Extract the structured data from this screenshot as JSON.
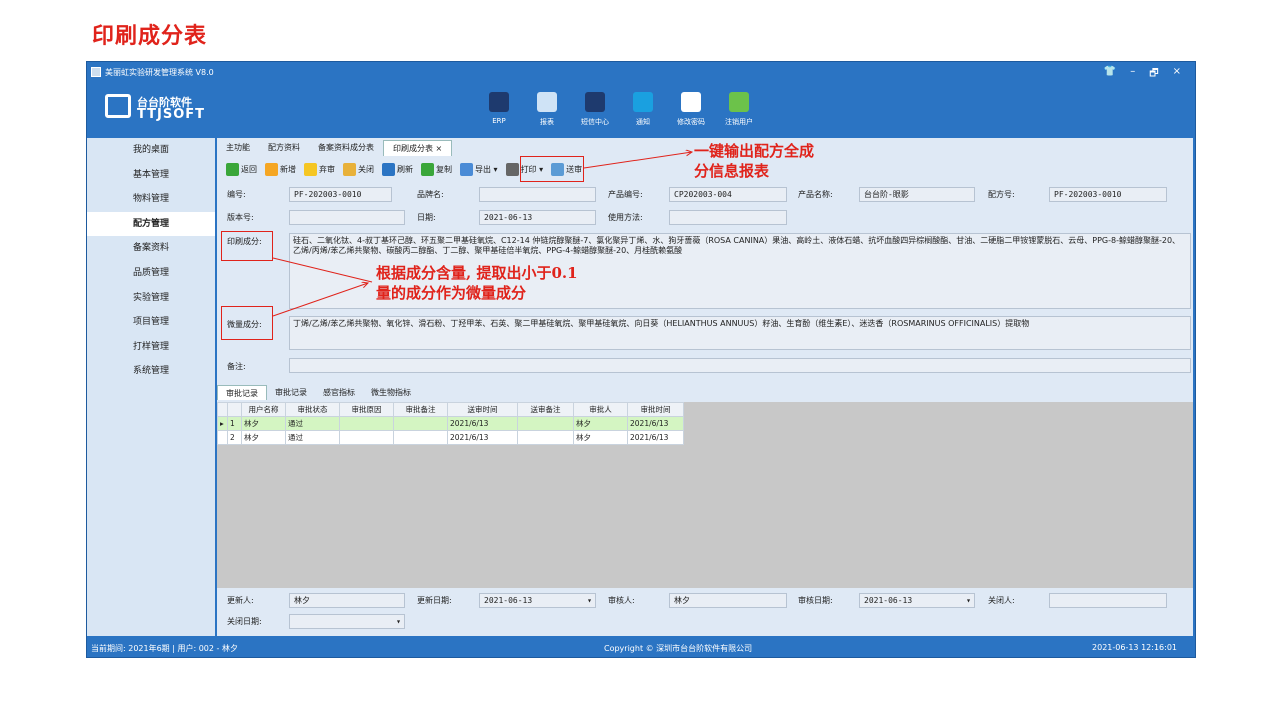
{
  "slide": {
    "title": "印刷成分表"
  },
  "window": {
    "title": "美丽虹实验研发管理系统",
    "version": "V8.0",
    "logo_line1": "台台阶软件",
    "logo_line2": "TTJSOFT",
    "controls": [
      "👕",
      "–",
      "🗗",
      "×"
    ]
  },
  "topnav": [
    {
      "label": "ERP",
      "color": "#1e3a6e"
    },
    {
      "label": "报表",
      "color": "#cfe3f6"
    },
    {
      "label": "短信中心",
      "color": "#1e3a6e"
    },
    {
      "label": "通知",
      "color": "#1aa0e0"
    },
    {
      "label": "修改密码",
      "color": "#ffffff"
    },
    {
      "label": "注销用户",
      "color": "#6cc24a"
    }
  ],
  "sidebar": [
    {
      "label": "我的桌面"
    },
    {
      "label": "基本管理"
    },
    {
      "label": "物料管理"
    },
    {
      "label": "配方管理",
      "active": true
    },
    {
      "label": "备案资料"
    },
    {
      "label": "品质管理"
    },
    {
      "label": "实验管理"
    },
    {
      "label": "项目管理"
    },
    {
      "label": "打样管理"
    },
    {
      "label": "系统管理"
    }
  ],
  "tabs": [
    {
      "label": "主功能"
    },
    {
      "label": "配方资料"
    },
    {
      "label": "备案资料成分表"
    },
    {
      "label": "印刷成分表 ×",
      "active": true
    }
  ],
  "toolbar": [
    {
      "label": "返回",
      "color": "#3aa63a"
    },
    {
      "label": "新增",
      "color": "#f5a623"
    },
    {
      "label": "弃审",
      "color": "#f5c623"
    },
    {
      "label": "关闭",
      "color": "#e8b13a"
    },
    {
      "label": "刷新",
      "color": "#2b74c3"
    },
    {
      "label": "复制",
      "color": "#3aa63a"
    },
    {
      "label": "导出 ▾",
      "color": "#4a8bd6"
    },
    {
      "label": "打印 ▾",
      "color": "#666666"
    },
    {
      "label": "送审",
      "color": "#5b9bd5"
    }
  ],
  "form": {
    "code_label": "编号:",
    "code": "PF-202003-0010",
    "brand_label": "品牌名:",
    "brand": "",
    "product_code_label": "产品编号:",
    "product_code": "CP202003-004",
    "product_name_label": "产品名称:",
    "product_name": "台台阶-眼影",
    "formula_no_label": "配方号:",
    "formula_no": "PF-202003-0010",
    "version_label": "版本号:",
    "version": "",
    "date_label": "日期:",
    "date": "2021-06-13",
    "usage_label": "使用方法:",
    "usage": "",
    "print_label": "印刷成分:",
    "print_ingredients": "硅石、二氧化钛、4-叔丁基环己醇、环五聚二甲基硅氧烷、C12-14 仲链烷醇聚醚-7、氯化聚异丁烯、水、狗牙蔷薇（ROSA CANINA）果油、高岭土、液体石蜡、抗坏血酸四异棕榈酸酯、甘油、二硬脂二甲铵锂蒙脱石、云母、PPG-8-鲸蜡醇聚醚-20、乙烯/丙烯/苯乙烯共聚物、碳酸丙二醇酯、丁二醇、聚甲基硅倍半氧烷、PPG-4-鲸蜡醇聚醚-20、月桂酰赖氨酸",
    "trace_label": "微量成分:",
    "trace_ingredients": "丁烯/乙烯/苯乙烯共聚物、氧化锌、滑石粉、丁羟甲苯、石英、聚二甲基硅氧烷、聚甲基硅氧烷、向日葵（HELIANTHUS ANNUUS）籽油、生育酚（维生素E）、迷迭香（ROSMARINUS OFFICINALIS）提取物",
    "remark_label": "备注:",
    "remark": ""
  },
  "subtabs": [
    {
      "label": "审批记录",
      "active": true
    },
    {
      "label": "审批记录"
    },
    {
      "label": "感官指标"
    },
    {
      "label": "微生物指标"
    }
  ],
  "table": {
    "headers": [
      "",
      "",
      "用户名称",
      "审批状态",
      "审批原因",
      "审批备注",
      "送审时间",
      "送审备注",
      "审批人",
      "审批时间"
    ],
    "rows": [
      {
        "mark": "▸",
        "no": "1",
        "user": "林夕",
        "status": "通过",
        "reason": "",
        "note": "",
        "send_time": "2021/6/13",
        "send_note": "",
        "approver": "林夕",
        "approve_time": "2021/6/13"
      },
      {
        "mark": "",
        "no": "2",
        "user": "林夕",
        "status": "通过",
        "reason": "",
        "note": "",
        "send_time": "2021/6/13",
        "send_note": "",
        "approver": "林夕",
        "approve_time": "2021/6/13"
      }
    ]
  },
  "footer": {
    "updater_label": "更新人:",
    "updater": "林夕",
    "update_date_label": "更新日期:",
    "update_date": "2021-06-13",
    "reviewer_label": "审核人:",
    "reviewer": "林夕",
    "review_date_label": "审核日期:",
    "review_date": "2021-06-13",
    "closer_label": "关闭人:",
    "closer": "",
    "close_date_label": "关闭日期:",
    "close_date": ""
  },
  "status": {
    "period": "当前期间: 2021年6期 | 用户: 002 - 林夕",
    "copyright": "Copyright © 深圳市台台阶软件有限公司",
    "datetime": "2021-06-13 12:16:01"
  },
  "callouts": {
    "export": "一键输出配方全成\n分信息报表",
    "trace": "根据成分含量, 提取出小于0.1\n量的成分作为微量成分"
  }
}
